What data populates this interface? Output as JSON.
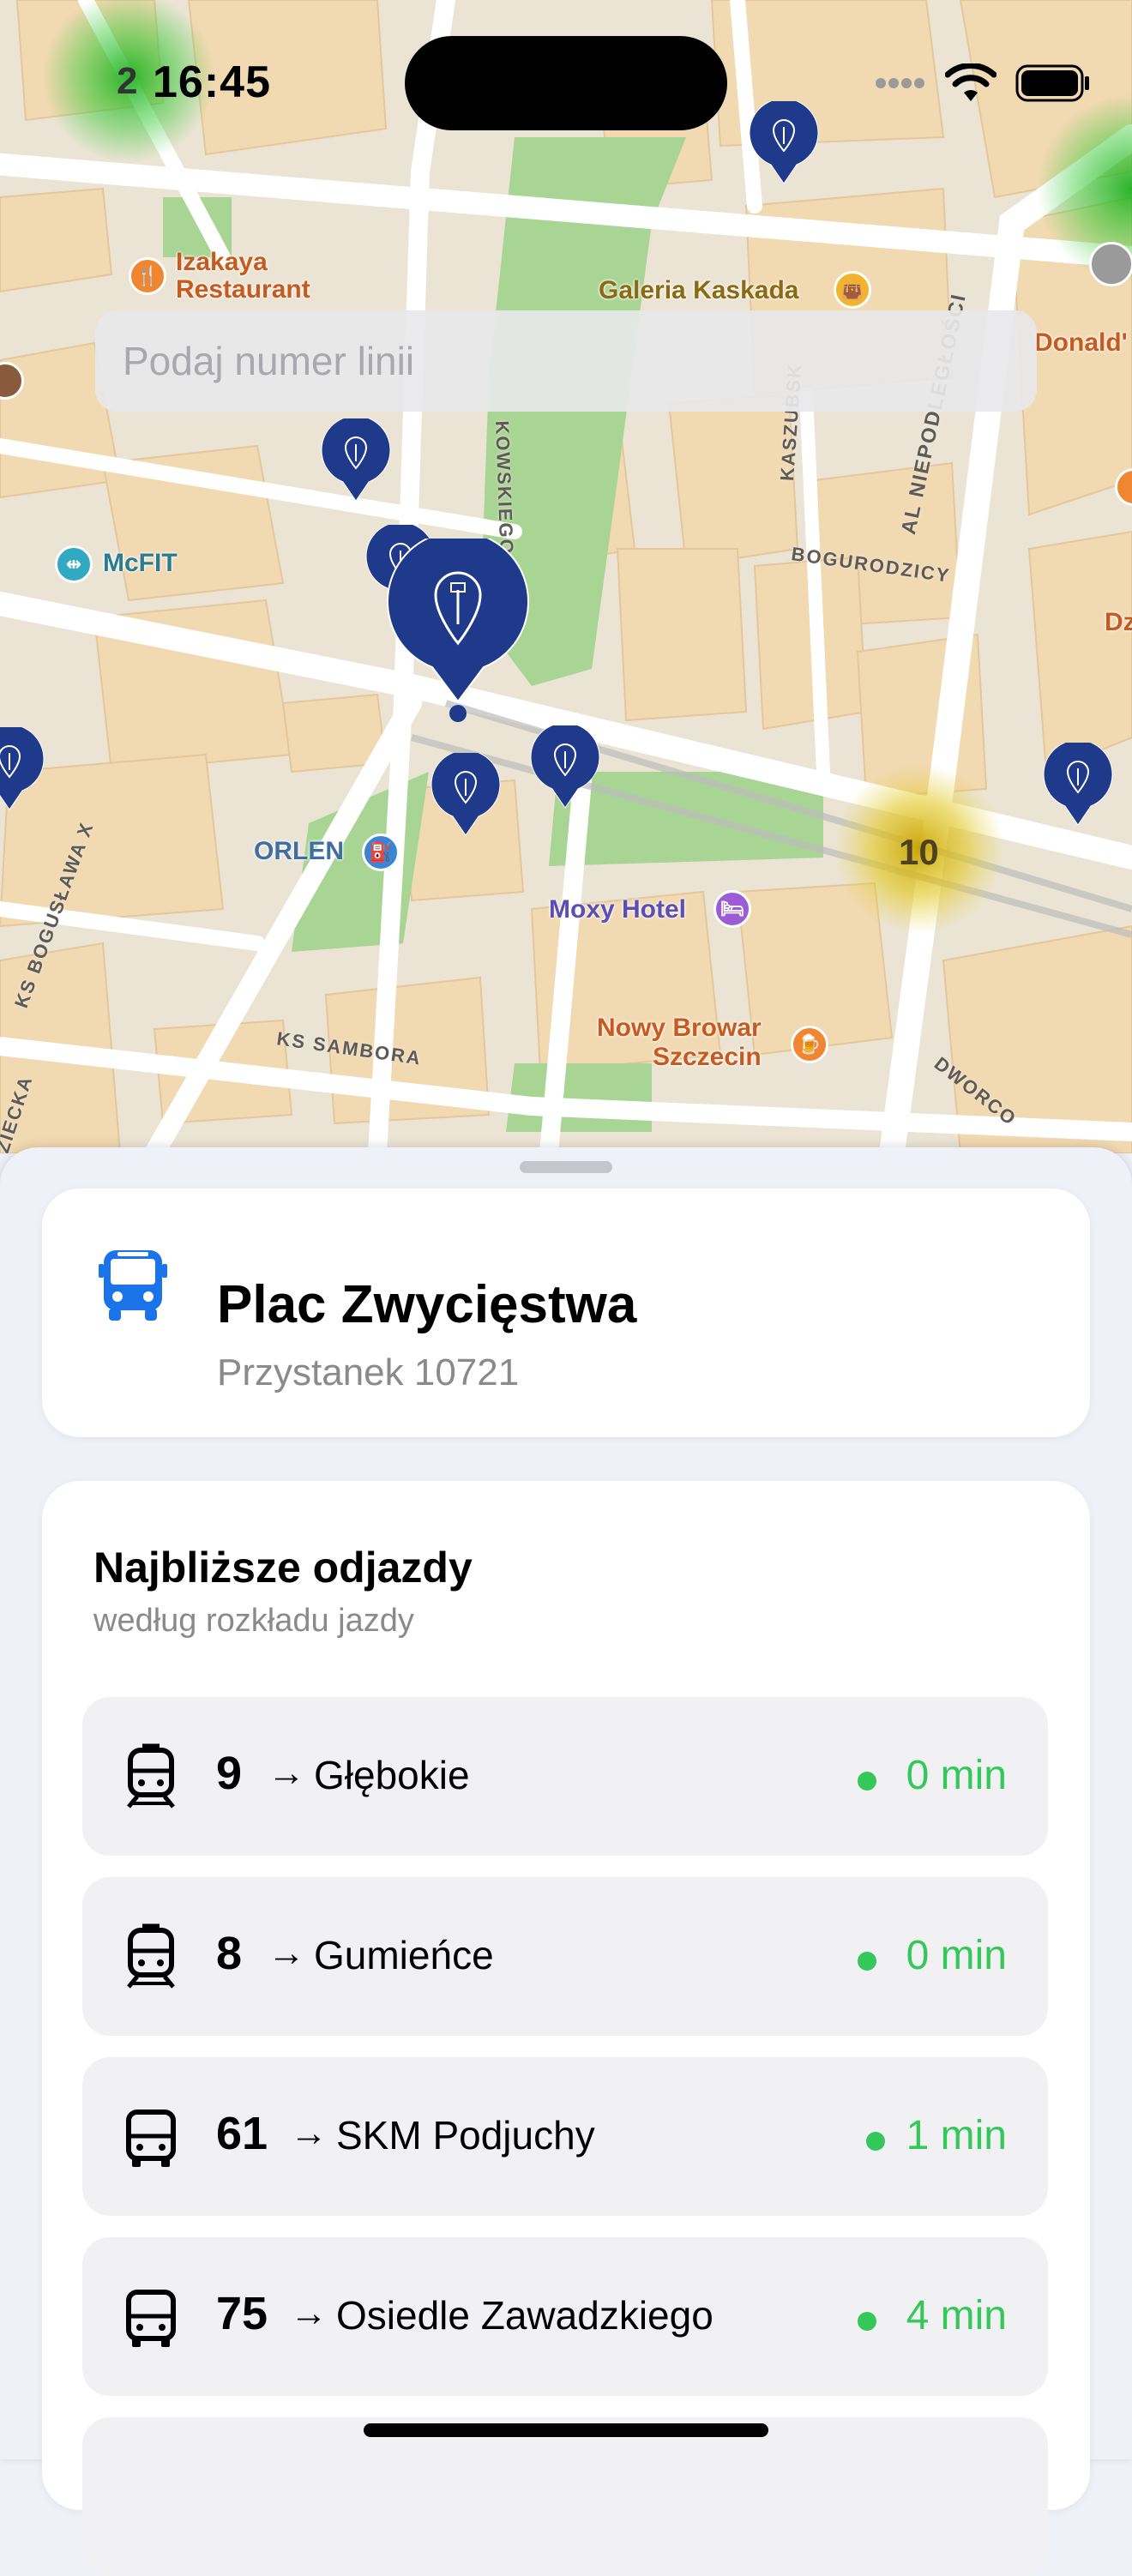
{
  "status_bar": {
    "time": "16:45"
  },
  "search": {
    "placeholder": "Podaj numer linii",
    "value": ""
  },
  "map": {
    "labels": {
      "izakaya": "Izakaya\nRestaurant",
      "galeria": "Galeria Kaskada",
      "mcdonalds": "Donald'",
      "mcfit": "McFIT",
      "orlen": "ORLEN",
      "moxy": "Moxy Hotel",
      "browar": "Nowy Browar\nSzczecin",
      "partial_d": "Dz"
    },
    "streets": {
      "bogurodzicy": "BOGURODZICY",
      "niepodleglosci": "AL NIEPODLEGŁOŚCI",
      "kaszubska": "KASZUBSK",
      "sambora": "KS SAMBORA",
      "owskiego": "KOWSKIEGO",
      "boguslawa": "KS BOGUSŁAWA X",
      "dworco": "DWORCO",
      "ziecka": "ZIECKA"
    },
    "cluster_count": "10",
    "left_badge": "2"
  },
  "stop": {
    "name": "Plac Zwycięstwa",
    "subtitle": "Przystanek 10721"
  },
  "departures": {
    "title": "Najbliższe odjazdy",
    "subtitle": "według rozkładu jazdy",
    "items": [
      {
        "vehicle": "tram-icon",
        "line": "9",
        "destination": "Głębokie",
        "eta": "0 min"
      },
      {
        "vehicle": "tram-icon",
        "line": "8",
        "destination": "Gumieńce",
        "eta": "0 min"
      },
      {
        "vehicle": "bus-icon",
        "line": "61",
        "destination": "SKM Podjuchy",
        "eta": "1 min"
      },
      {
        "vehicle": "bus-icon",
        "line": "75",
        "destination": "Osiedle Zawadzkiego",
        "eta": "4 min"
      }
    ],
    "arrow": "→"
  },
  "colors": {
    "pin": "#1f3a8a",
    "accent_blue": "#1a73e8",
    "eta_green": "#34c759"
  }
}
